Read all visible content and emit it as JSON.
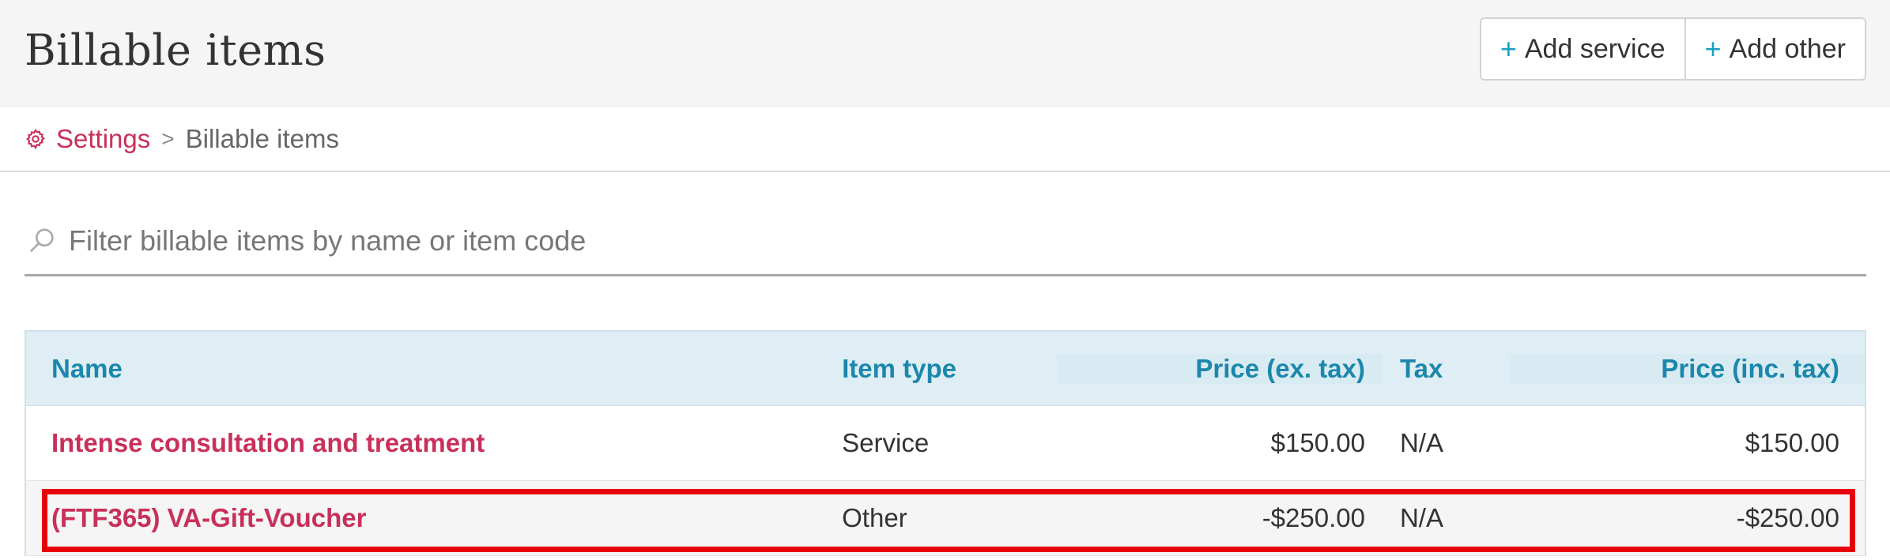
{
  "header": {
    "title": "Billable items",
    "add_service_label": "Add service",
    "add_other_label": "Add other",
    "plus_glyph": "+"
  },
  "breadcrumb": {
    "settings_label": "Settings",
    "separator": ">",
    "current_label": "Billable items",
    "icon": "gear-icon"
  },
  "filter": {
    "placeholder": "Filter billable items by name or item code",
    "value": "",
    "icon": "search-icon"
  },
  "table": {
    "columns": {
      "name": "Name",
      "item_type": "Item type",
      "price_ex": "Price (ex. tax)",
      "tax": "Tax",
      "price_inc": "Price (inc. tax)"
    },
    "rows": [
      {
        "name": "Intense consultation and treatment",
        "item_type": "Service",
        "price_ex": "$150.00",
        "tax": "N/A",
        "price_inc": "$150.00"
      },
      {
        "name": "(FTF365) VA-Gift-Voucher",
        "item_type": "Other",
        "price_ex": "-$250.00",
        "tax": "N/A",
        "price_inc": "-$250.00"
      }
    ]
  },
  "colors": {
    "accent": "#c8305a",
    "header_text": "#1b87ac",
    "plus": "#1a9fc4",
    "highlight": "#e8000b"
  }
}
